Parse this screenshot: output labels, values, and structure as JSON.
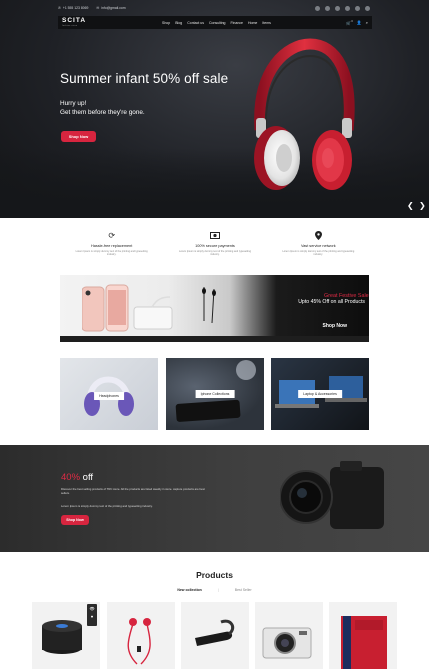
{
  "topbar": {
    "phone": "+1 555 123 8069",
    "email": "info@gmail.com",
    "social": [
      "facebook-icon",
      "twitter-icon",
      "google-plus-icon",
      "pinterest-icon",
      "youtube-icon",
      "instagram-icon"
    ]
  },
  "header": {
    "logo": "SCITA",
    "logo_tagline": "fashion store",
    "menu": [
      "Shop",
      "Blog",
      "Contact us",
      "Consulting",
      "Finance",
      "Home",
      "Items"
    ],
    "icons": [
      "cart-icon",
      "user-icon",
      "search-icon"
    ],
    "cart_count": "0"
  },
  "hero": {
    "title": "Summer infant 50% off sale",
    "subtitle_line1": "Hurry up!",
    "subtitle_line2": "Get them before they're gone.",
    "button": "Shop Now",
    "prev": "❮",
    "next": "❯"
  },
  "features": [
    {
      "icon": "refresh-icon",
      "title": "Hassle-free replacement",
      "text": "Lorem Ipsum is simply dummy text of the printing and typesetting industry."
    },
    {
      "icon": "money-icon",
      "title": "100% secure payments",
      "text": "Lorem Ipsum is simply dummy text of the printing and typesetting industry."
    },
    {
      "icon": "location-icon",
      "title": "Vast service network",
      "text": "Lorem Ipsum is simply dummy text of the printing and typesetting industry."
    }
  ],
  "banner1": {
    "line1": "Great Festive Sale",
    "line2": "Upto 45% Off on all Products",
    "cta": "Shop Now"
  },
  "categories": [
    {
      "label": "Headphones"
    },
    {
      "label": "Iphone Collections"
    },
    {
      "label": "Laptop & Accessories"
    }
  ],
  "banner2": {
    "percent": "40%",
    "off": "off",
    "text1": "Discover the best selling products of TRC store. All the products are listed weekly in store. capture products are best sellers.",
    "text2": "Lorem Ipsum is simply dummy text of the printing and typesetting industry.",
    "button": "Shop Now"
  },
  "products": {
    "title": "Products",
    "tabs": [
      "New collection",
      "Best Seller"
    ],
    "separator": "|",
    "items": [
      "speaker",
      "earphones",
      "bluetooth-headset",
      "camera",
      "phone-case"
    ]
  },
  "colors": {
    "accent": "#d7253f",
    "dark": "#101113"
  }
}
